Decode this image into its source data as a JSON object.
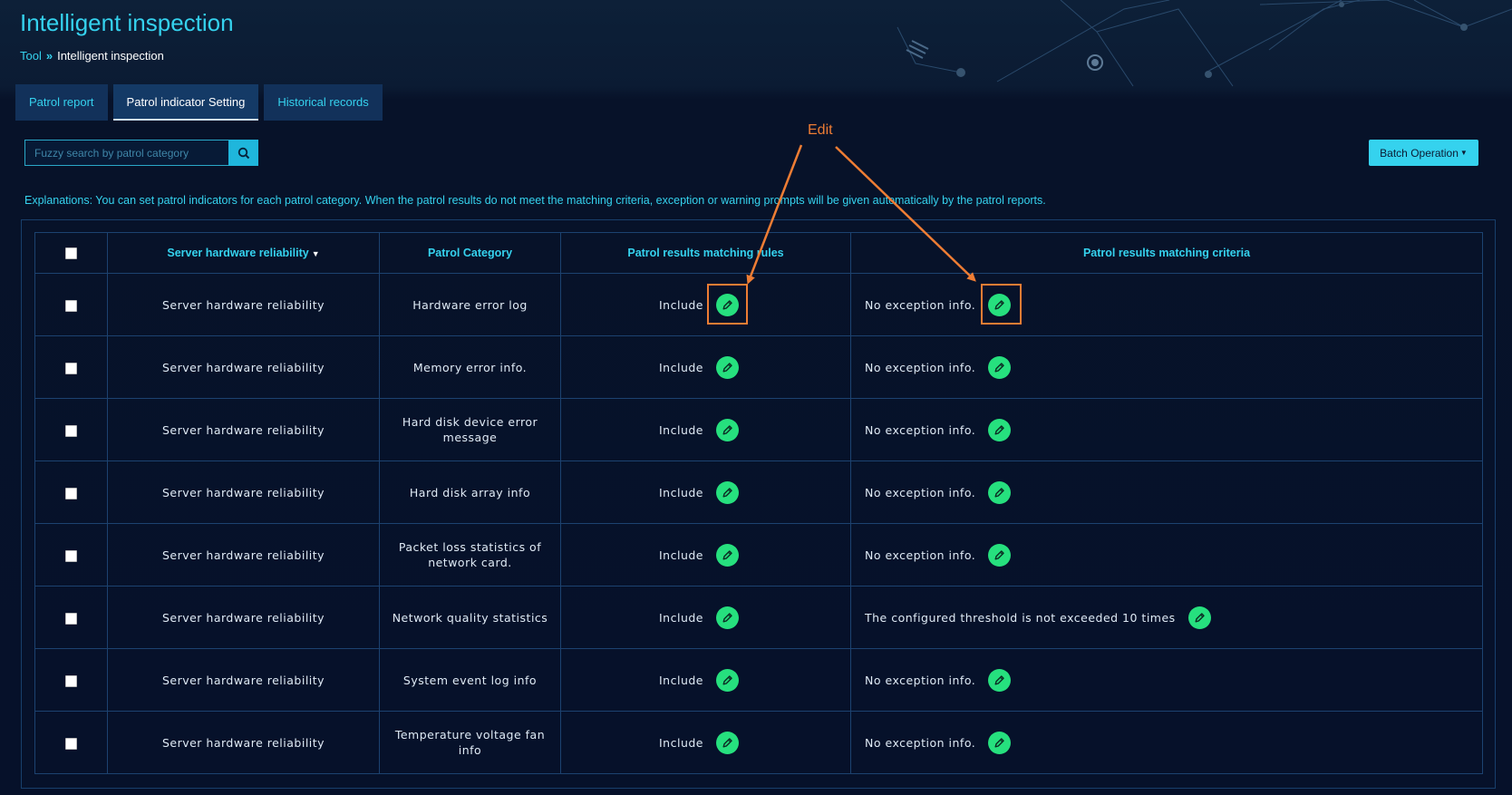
{
  "page": {
    "title": "Intelligent inspection"
  },
  "breadcrumb": {
    "root": "Tool",
    "separator": "»",
    "current": "Intelligent inspection"
  },
  "tabs": [
    {
      "label": "Patrol report",
      "active": false
    },
    {
      "label": "Patrol indicator Setting",
      "active": true
    },
    {
      "label": "Historical records",
      "active": false
    }
  ],
  "search": {
    "placeholder": "Fuzzy search by patrol category",
    "value": "",
    "icon": "search-icon"
  },
  "batch": {
    "label": "Batch Operation"
  },
  "explanation": "Explanations: You can set patrol indicators for each patrol category. When the patrol results do not meet the matching criteria, exception or warning prompts will be given automatically by the patrol reports.",
  "table": {
    "headers": {
      "filter": "Server hardware reliability",
      "category": "Patrol Category",
      "rules": "Patrol results matching rules",
      "criteria": "Patrol results matching criteria"
    },
    "rows": [
      {
        "group": "Server hardware reliability",
        "category": "Hardware error log",
        "rule": "Include",
        "criteria": "No exception info."
      },
      {
        "group": "Server hardware reliability",
        "category": "Memory error info.",
        "rule": "Include",
        "criteria": "No exception info."
      },
      {
        "group": "Server hardware reliability",
        "category": "Hard disk device error message",
        "rule": "Include",
        "criteria": "No exception info."
      },
      {
        "group": "Server hardware reliability",
        "category": "Hard disk array info",
        "rule": "Include",
        "criteria": "No exception info."
      },
      {
        "group": "Server hardware reliability",
        "category": "Packet loss statistics of network card.",
        "rule": "Include",
        "criteria": "No exception info."
      },
      {
        "group": "Server hardware reliability",
        "category": "Network quality statistics",
        "rule": "Include",
        "criteria": "The configured threshold is not exceeded 10 times"
      },
      {
        "group": "Server hardware reliability",
        "category": "System event log info",
        "rule": "Include",
        "criteria": "No exception info."
      },
      {
        "group": "Server hardware reliability",
        "category": "Temperature voltage fan info",
        "rule": "Include",
        "criteria": "No exception info."
      }
    ]
  },
  "annotation": {
    "label": "Edit",
    "color": "#ee7d34"
  },
  "colors": {
    "accent": "#35d2ee",
    "edit": "#26e07e",
    "background": "#071229"
  }
}
